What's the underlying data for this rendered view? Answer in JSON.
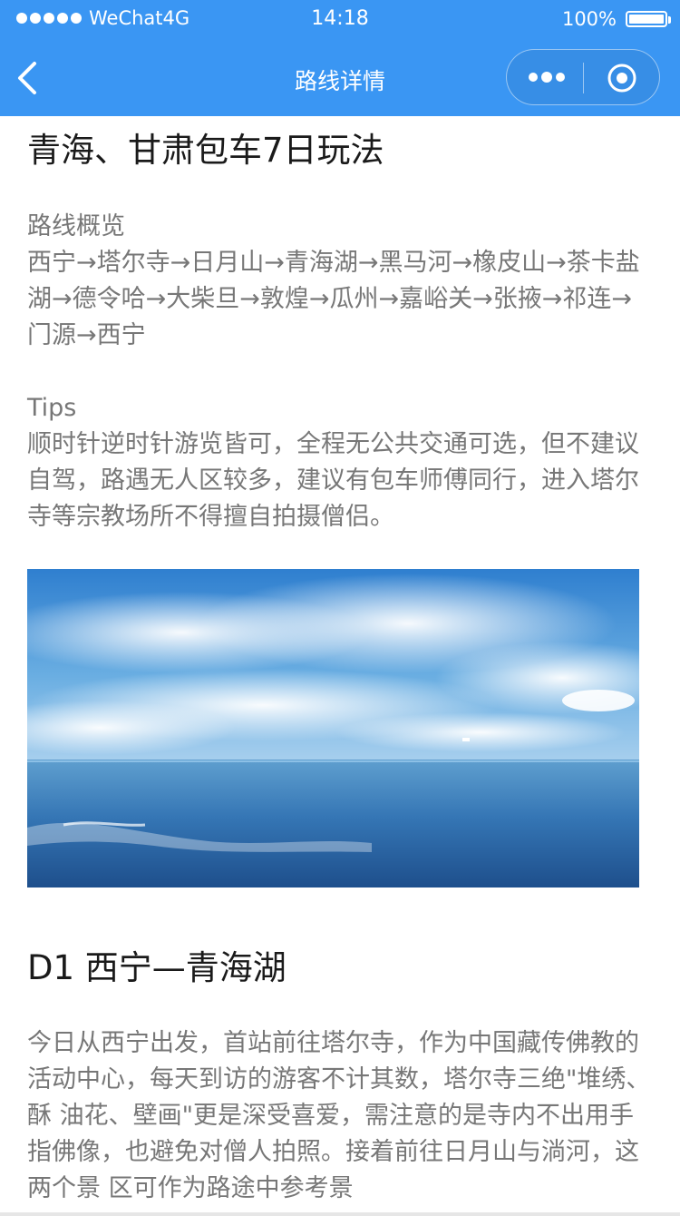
{
  "status_bar": {
    "carrier": "WeChat4G",
    "time": "14:18",
    "battery": "100%"
  },
  "nav": {
    "title": "路线详情"
  },
  "article": {
    "title": "青海、甘肃包车7日玩法",
    "overview_label": "路线概览",
    "overview_text": "西宁→塔尔寺→日月山→青海湖→黑马河→橡皮山→茶卡盐湖→德令哈→大柴旦→敦煌→瓜州→嘉峪关→张掖→祁连→门源→西宁",
    "tips_label": "Tips",
    "tips_text": "顺时针逆时针游览皆可，全程无公共交通可选，但不建议自驾，路遇无人区较多，建议有包车师傅同行，进入塔尔寺等宗教场所不得擅自拍摄僧侣。",
    "day1_title": "D1 西宁—青海湖",
    "day1_text": "今日从西宁出发，首站前往塔尔寺，作为中国藏传佛教的活动中心，每天到访的游客不计其数，塔尔寺三绝\"堆绣、酥 油花、壁画\"更是深受喜爱，需注意的是寺内不出用手指佛像，也避免对僧人拍照。接着前往日月山与淌河，这两个景 区可作为路途中参考景"
  },
  "icons": {
    "back": "chevron-left-icon",
    "more": "more-dots-icon",
    "close": "target-close-icon"
  },
  "colors": {
    "header_bg": "#3a96f3",
    "text_gray": "#777777",
    "title_dark": "#1a1a1a"
  }
}
